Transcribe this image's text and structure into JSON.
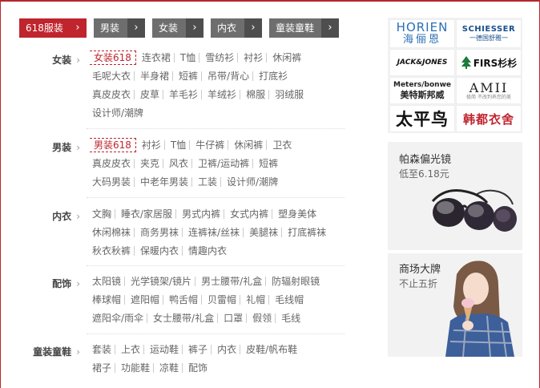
{
  "tabs": [
    {
      "label": "618服装",
      "arrow": "›"
    },
    {
      "label": "男装",
      "arrow": "›"
    },
    {
      "label": "女装",
      "arrow": "›"
    },
    {
      "label": "内衣",
      "arrow": "›"
    },
    {
      "label": "童装童鞋",
      "arrow": "›"
    }
  ],
  "categories": [
    {
      "title": "女装",
      "arrow": "›",
      "rows": [
        [
          "女装618",
          "连衣裙",
          "T恤",
          "雪纺衫",
          "衬衫",
          "休闲裤"
        ],
        [
          "毛呢大衣",
          "半身裙",
          "短裤",
          "吊带/背心",
          "打底衫"
        ],
        [
          "真皮皮衣",
          "皮草",
          "羊毛衫",
          "羊绒衫",
          "棉服",
          "羽绒服"
        ],
        [
          "设计师/潮牌"
        ]
      ]
    },
    {
      "title": "男装",
      "arrow": "›",
      "rows": [
        [
          "男装618",
          "衬衫",
          "T恤",
          "牛仔裤",
          "休闲裤",
          "卫衣"
        ],
        [
          "真皮皮衣",
          "夹克",
          "风衣",
          "卫裤/运动裤",
          "短裤"
        ],
        [
          "大码男装",
          "中老年男装",
          "工装",
          "设计师/潮牌"
        ]
      ]
    },
    {
      "title": "内衣",
      "arrow": "›",
      "rows": [
        [
          "文胸",
          "睡衣/家居服",
          "男式内裤",
          "女式内裤",
          "塑身美体"
        ],
        [
          "休闲棉袜",
          "商务男袜",
          "连裤袜/丝袜",
          "美腿袜",
          "打底裤袜"
        ],
        [
          "秋衣秋裤",
          "保暖内衣",
          "情趣内衣"
        ]
      ]
    },
    {
      "title": "配饰",
      "arrow": "›",
      "rows": [
        [
          "太阳镜",
          "光学镜架/镜片",
          "男士腰带/礼盒",
          "防辐射眼镜"
        ],
        [
          "棒球帽",
          "遮阳帽",
          "鸭舌帽",
          "贝雷帽",
          "礼帽",
          "毛线帽"
        ],
        [
          "遮阳伞/雨伞",
          "女士腰带/礼盒",
          "口罩",
          "假领",
          "毛线"
        ]
      ]
    },
    {
      "title": "童装童鞋",
      "arrow": "›",
      "rows": [
        [
          "套装",
          "上衣",
          "运动鞋",
          "裤子",
          "内衣",
          "皮鞋/帆布鞋"
        ],
        [
          "裙子",
          "功能鞋",
          "凉鞋",
          "配饰"
        ]
      ]
    }
  ],
  "brands": {
    "horien_en": "HORIEN",
    "horien_cn": "海俪恩",
    "schiesser_en": "SCHIESSER",
    "schiesser_cn": "一德国舒雅一",
    "jackjones": "JACK&JONES",
    "firs": "FIRS杉杉",
    "metersbonwe_en": "Meters/bonwe",
    "metersbonwe_cn": "美特斯邦威",
    "amii": "AMII",
    "amii_sub": "极简 不改判养您的美",
    "taipingniao": "太平鸟",
    "handu": "韩都衣舍"
  },
  "promos": [
    {
      "title": "帕森偏光镜",
      "subtitle": "低至6.18元"
    },
    {
      "title": "商场大牌",
      "subtitle": "不止五折"
    }
  ],
  "colors": {
    "accent": "#c0242d",
    "tab_gray": "#6e6e6e",
    "panel": "#f2f2f2"
  }
}
